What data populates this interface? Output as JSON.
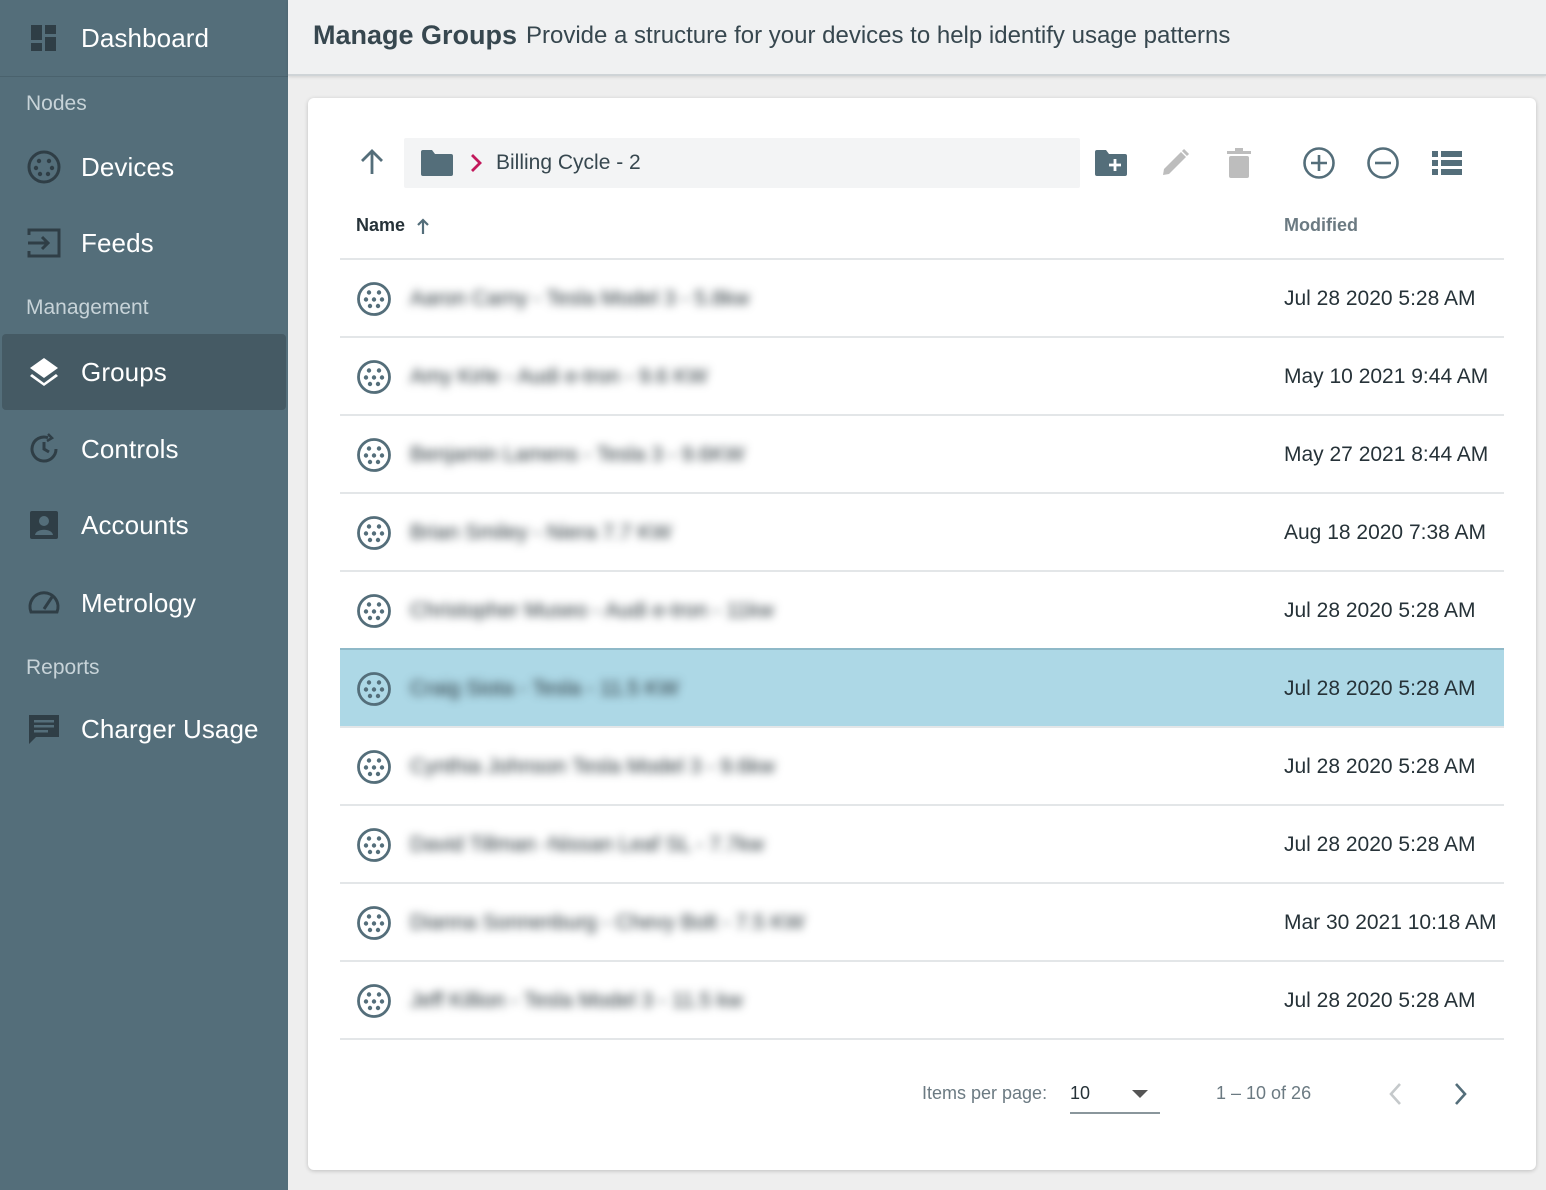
{
  "sidebar": {
    "dashboard": "Dashboard",
    "sections": {
      "nodes": "Nodes",
      "management": "Management",
      "reports": "Reports"
    },
    "items": {
      "devices": "Devices",
      "feeds": "Feeds",
      "groups": "Groups",
      "controls": "Controls",
      "accounts": "Accounts",
      "metrology": "Metrology",
      "charger_usage": "Charger Usage"
    },
    "active_item": "Groups"
  },
  "header": {
    "title": "Manage Groups",
    "subtitle": "Provide a structure for your devices to help identify usage patterns"
  },
  "toolbar": {
    "breadcrumb": "Billing Cycle - 2",
    "icons": [
      "arrow-up-icon",
      "folder-icon",
      "chevron-right-icon",
      "create-folder-icon",
      "edit-icon",
      "delete-icon",
      "add-circle-icon",
      "remove-circle-icon",
      "list-view-icon"
    ]
  },
  "table": {
    "columns": {
      "name": "Name",
      "modified": "Modified"
    },
    "sort": "name-ascending",
    "rows": [
      {
        "name": "Aaron Carny - Tesla Model 3 - 5.8kw",
        "modified": "Jul 28 2020 5:28 AM",
        "selected": false
      },
      {
        "name": "Amy Kirle - Audi e-tron - 9.6 KW",
        "modified": "May 10 2021 9:44 AM",
        "selected": false
      },
      {
        "name": "Benjamin Lamens - Tesla 3 - 9.6KW",
        "modified": "May 27 2021 8:44 AM",
        "selected": false
      },
      {
        "name": "Brian Smiley - Niera 7.7 KW",
        "modified": "Aug 18 2020 7:38 AM",
        "selected": false
      },
      {
        "name": "Christopher Museo - Audi e-tron - 11kw",
        "modified": "Jul 28 2020 5:28 AM",
        "selected": false
      },
      {
        "name": "Craig Siota - Tesla - 11.5 KW",
        "modified": "Jul 28 2020 5:28 AM",
        "selected": true
      },
      {
        "name": "Cynthia Johnson Tesla Model 3 - 9.6kw",
        "modified": "Jul 28 2020 5:28 AM",
        "selected": false
      },
      {
        "name": "David Tillman -Nissan Leaf SL - 7.7kw",
        "modified": "Jul 28 2020 5:28 AM",
        "selected": false
      },
      {
        "name": "Dianna Sonnenburg - Chevy Bolt - 7.5 KW",
        "modified": "Mar 30 2021 10:18 AM",
        "selected": false
      },
      {
        "name": "Jeff Killion - Tesla Model 3 - 11.5 kw",
        "modified": "Jul 28 2020 5:28 AM",
        "selected": false
      }
    ]
  },
  "pagination": {
    "items_per_page_label": "Items per page:",
    "items_per_page": "10",
    "range": "1 – 10 of 26"
  },
  "colors": {
    "sidebar": "#546e7a",
    "sidebar_active": "#455a64",
    "selected_row": "#add8e6",
    "accent": "#c2185b"
  }
}
